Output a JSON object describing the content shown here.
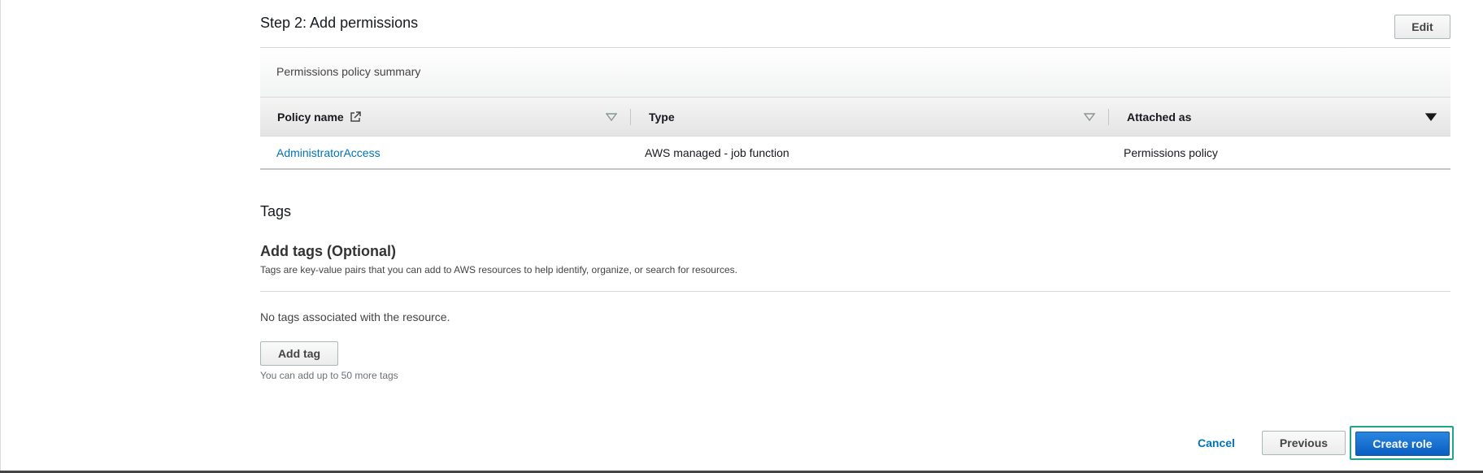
{
  "step": {
    "title": "Step 2: Add permissions",
    "edit_label": "Edit"
  },
  "permissions": {
    "summary_title": "Permissions policy summary",
    "columns": [
      "Policy name",
      "Type",
      "Attached as"
    ],
    "rows": [
      {
        "policy_name": "AdministratorAccess",
        "type": "AWS managed - job function",
        "attached_as": "Permissions policy"
      }
    ]
  },
  "tags": {
    "section_title": "Tags",
    "add_title": "Add tags (Optional)",
    "description": "Tags are key-value pairs that you can add to AWS resources to help identify, organize, or search for resources.",
    "empty_text": "No tags associated with the resource.",
    "add_tag_label": "Add tag",
    "hint": "You can add up to 50 more tags"
  },
  "footer": {
    "cancel_label": "Cancel",
    "previous_label": "Previous",
    "create_label": "Create role"
  },
  "colors": {
    "link": "#0073bb",
    "primary_button": "#0a5ec2",
    "focus_ring": "#1fa58a"
  },
  "icons": [
    "external-link-icon",
    "sort-down-icon",
    "sort-down-filled-icon"
  ]
}
